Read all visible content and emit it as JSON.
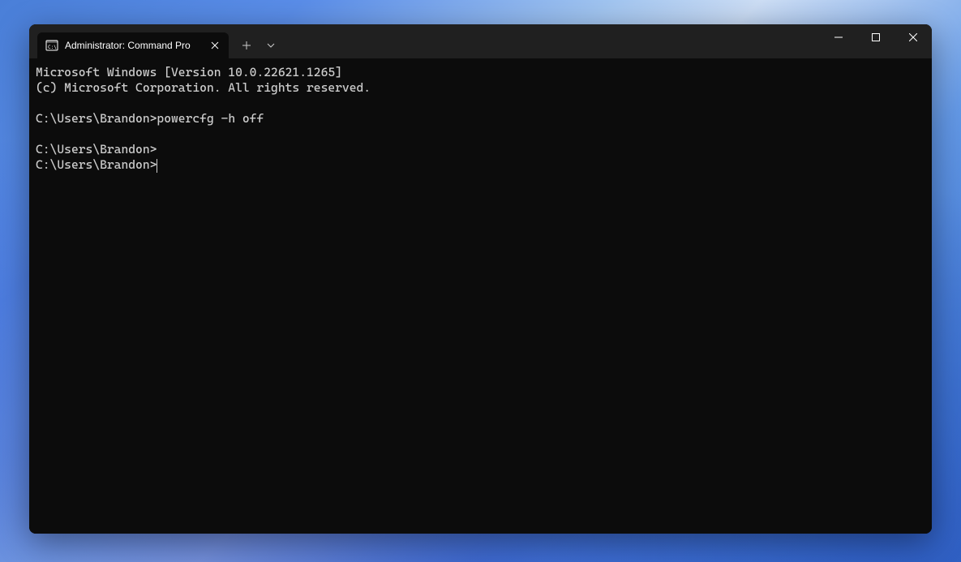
{
  "window": {
    "tab_title": "Administrator: Command Pro"
  },
  "terminal": {
    "line1": "Microsoft Windows [Version 10.0.22621.1265]",
    "line2": "(c) Microsoft Corporation. All rights reserved.",
    "line3": "",
    "prompt1": "C:\\Users\\Brandon>",
    "command1": "powercfg -h off",
    "line5": "",
    "prompt2": "C:\\Users\\Brandon>",
    "prompt3": "C:\\Users\\Brandon>"
  }
}
